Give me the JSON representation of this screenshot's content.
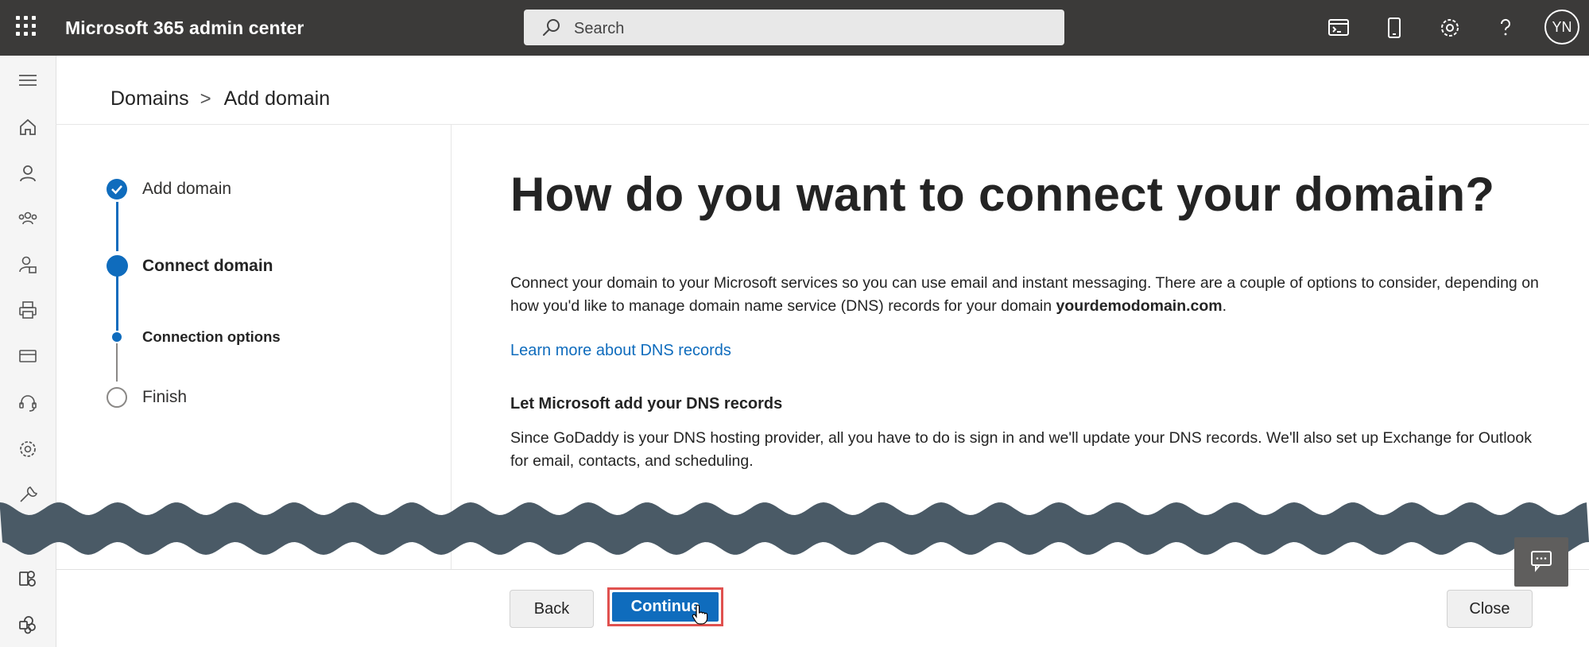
{
  "header": {
    "app_title": "Microsoft 365 admin center",
    "search_placeholder": "Search",
    "avatar_initials": "YN",
    "icons": [
      "waffle-icon",
      "terminal-icon",
      "mobile-icon",
      "gear-icon",
      "help-icon"
    ]
  },
  "rail": {
    "icons": [
      "menu-icon",
      "home-icon",
      "user-icon",
      "groups-icon",
      "user-roles-icon",
      "printer-icon",
      "billing-icon",
      "support-icon",
      "settings-icon",
      "setup-icon",
      "exchange-icon",
      "sharepoint-icon"
    ]
  },
  "breadcrumb": {
    "parent": "Domains",
    "separator": ">",
    "current": "Add domain"
  },
  "stepper": {
    "steps": [
      {
        "label": "Add domain",
        "state": "completed"
      },
      {
        "label": "Connect domain",
        "state": "current"
      },
      {
        "label": "Connection options",
        "state": "current-substep"
      },
      {
        "label": "Finish",
        "state": "pending"
      }
    ]
  },
  "content": {
    "heading": "How do you want to connect your domain?",
    "intro_text": "Connect your domain to your Microsoft services so you can use email and instant messaging. There are a couple of options to consider, depending on how you'd like to manage domain name service (DNS) records for your domain ",
    "domain_name": "yourdemodomain.com",
    "intro_end": ".",
    "learn_more": "Learn more about DNS records",
    "option_title": "Let Microsoft add your DNS records",
    "option_text": "Since GoDaddy is your DNS hosting provider, all you have to do is sign in and we'll update your DNS records. We'll also set up Exchange for Outlook for email, contacts, and scheduling."
  },
  "footer": {
    "back_label": "Back",
    "continue_label": "Continue",
    "close_label": "Close"
  },
  "colors": {
    "topbar": "#3b3a39",
    "accent": "#0f6cbd",
    "highlight": "#e0514f",
    "wave": "#4a5a66"
  }
}
